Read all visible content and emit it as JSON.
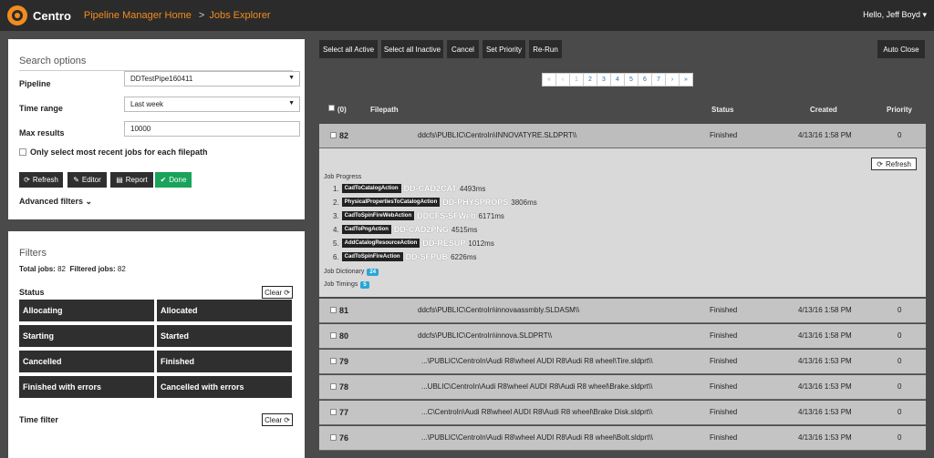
{
  "header": {
    "brand": "Centro",
    "crumb1": "Pipeline Manager Home",
    "crumb_sep": ">",
    "crumb2": "Jobs Explorer",
    "user": "Hello, Jeff Boyd ▾"
  },
  "search": {
    "title": "Search options",
    "pipeline_label": "Pipeline",
    "pipeline_value": "DDTestPipe160411",
    "time_label": "Time range",
    "time_value": "Last week",
    "max_label": "Max results",
    "max_value": "10000",
    "recent_label": "Only select most recent jobs for each filepath",
    "refresh": "Refresh",
    "editor": "Editor",
    "report": "Report",
    "done": "Done",
    "advanced": "Advanced filters"
  },
  "filters": {
    "title": "Filters",
    "total_label": "Total jobs:",
    "total_value": "82",
    "filtered_label": "Filtered jobs:",
    "filtered_value": "82",
    "status_label": "Status",
    "clear": "Clear",
    "statuses": [
      "Allocating",
      "Allocated",
      "Starting",
      "Started",
      "Cancelled",
      "Finished",
      "Finished with errors",
      "Cancelled with errors"
    ],
    "time_filter": "Time filter"
  },
  "toolbar": {
    "select_active": "Select all Active",
    "select_inactive": "Select all Inactive",
    "cancel": "Cancel",
    "set_priority": "Set Priority",
    "rerun": "Re-Run",
    "auto_close": "Auto Close"
  },
  "pager": [
    "«",
    "‹",
    "1",
    "2",
    "3",
    "4",
    "5",
    "6",
    "7",
    "›",
    "»"
  ],
  "table": {
    "selected": "(0)",
    "col_filepath": "Filepath",
    "col_status": "Status",
    "col_created": "Created",
    "col_priority": "Priority",
    "rows": [
      {
        "id": "82",
        "filepath": "ddcfs\\PUBLIC\\CentroIn\\INNOVATYRE.SLDPRT\\\\",
        "status": "Finished",
        "created": "4/13/16 1:58 PM",
        "priority": "0"
      },
      {
        "id": "81",
        "filepath": "ddcfs\\PUBLIC\\CentroIn\\innovaassmbly.SLDASM\\\\",
        "status": "Finished",
        "created": "4/13/16 1:58 PM",
        "priority": "0"
      },
      {
        "id": "80",
        "filepath": "ddcfs\\PUBLIC\\CentroIn\\innova.SLDPRT\\\\",
        "status": "Finished",
        "created": "4/13/16 1:58 PM",
        "priority": "0"
      },
      {
        "id": "79",
        "filepath": "...\\PUBLIC\\CentroIn\\Audi R8\\wheel AUDI R8\\Audi R8 wheel\\Tire.sldprt\\\\",
        "status": "Finished",
        "created": "4/13/16 1:53 PM",
        "priority": "0"
      },
      {
        "id": "78",
        "filepath": "...UBLIC\\CentroIn\\Audi R8\\wheel AUDI R8\\Audi R8 wheel\\Brake.sldprt\\\\",
        "status": "Finished",
        "created": "4/13/16 1:53 PM",
        "priority": "0"
      },
      {
        "id": "77",
        "filepath": "...C\\CentroIn\\Audi R8\\wheel AUDI R8\\Audi R8 wheel\\Brake Disk.sldprt\\\\",
        "status": "Finished",
        "created": "4/13/16 1:53 PM",
        "priority": "0"
      },
      {
        "id": "76",
        "filepath": "...\\PUBLIC\\CentroIn\\Audi R8\\wheel AUDI R8\\Audi R8 wheel\\Bolt.sldprt\\\\",
        "status": "Finished",
        "created": "4/13/16 1:53 PM",
        "priority": "0"
      }
    ]
  },
  "details": {
    "progress_label": "Job Progress",
    "refresh": "Refresh",
    "steps": [
      {
        "n": "1.",
        "action": "CadToCatalogAction",
        "code": "DD-CAD2CAT",
        "ms": "4493ms"
      },
      {
        "n": "2.",
        "action": "PhysicalPropertiesToCatalogAction",
        "code": "DD-PHYSPROPS",
        "ms": "3806ms"
      },
      {
        "n": "3.",
        "action": "CadToSpinFireWebAction",
        "code": "DDCFS-SFWeb",
        "ms": "6171ms"
      },
      {
        "n": "4.",
        "action": "CadToPngAction",
        "code": "DD-CAD2PNG",
        "ms": "4515ms"
      },
      {
        "n": "5.",
        "action": "AddCatalogResourceAction",
        "code": "DD-RESUP",
        "ms": "1012ms"
      },
      {
        "n": "6.",
        "action": "CadToSpinFireAction",
        "code": "DD-SFPUB",
        "ms": "6226ms"
      }
    ],
    "dictionary_label": "Job Dictionary",
    "dictionary_count": "24",
    "timings_label": "Job Timings",
    "timings_count": "5"
  }
}
